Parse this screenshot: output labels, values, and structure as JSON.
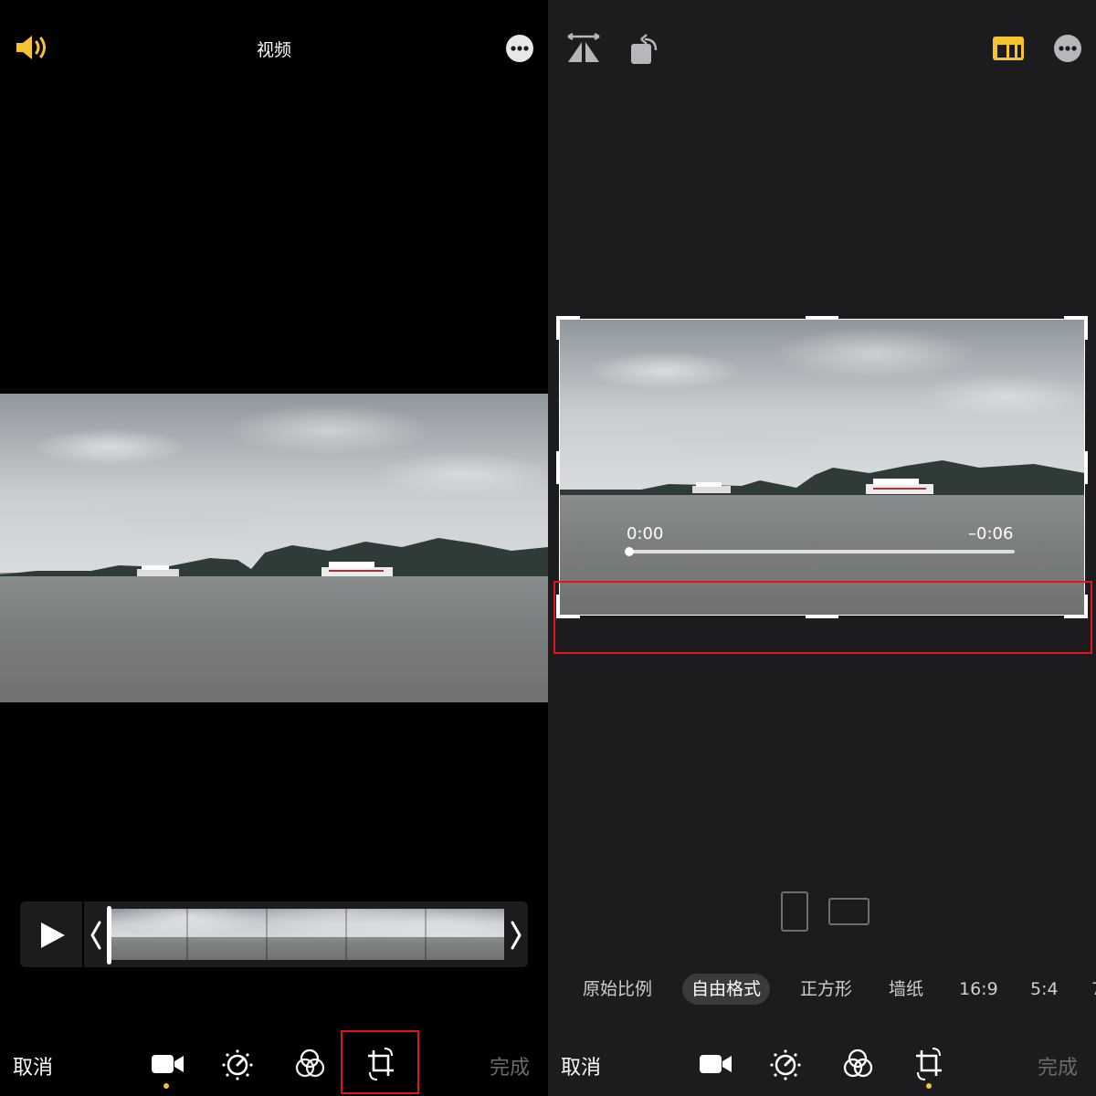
{
  "left_panel": {
    "title": "视频",
    "cancel_label": "取消",
    "done_label": "完成",
    "toolbar_icons": [
      "video-camera-icon",
      "adjust-dial-icon",
      "filters-icon",
      "crop-rotate-icon"
    ],
    "toolbar_active": "video-camera-icon",
    "highlighted_tool": "crop-rotate-icon",
    "accent_color": "#f6c431",
    "highlight_color": "#e3131b"
  },
  "right_panel": {
    "cancel_label": "取消",
    "done_label": "完成",
    "playback": {
      "elapsed": "0:00",
      "remaining": "–0:06",
      "progress": 0.0
    },
    "aspect_ratios": [
      "原始比例",
      "自由格式",
      "正方形",
      "墙纸",
      "16:9",
      "5:4",
      "7"
    ],
    "aspect_selected": "自由格式",
    "orientation_options": [
      "portrait-frame-icon",
      "landscape-frame-icon"
    ],
    "toolbar_icons": [
      "video-camera-icon",
      "adjust-dial-icon",
      "filters-icon",
      "crop-rotate-icon"
    ],
    "toolbar_active": "crop-rotate-icon",
    "top_icons": [
      "flip-horizontal-icon",
      "rotate-icon",
      "aspect-ratio-icon",
      "more-icon"
    ]
  }
}
